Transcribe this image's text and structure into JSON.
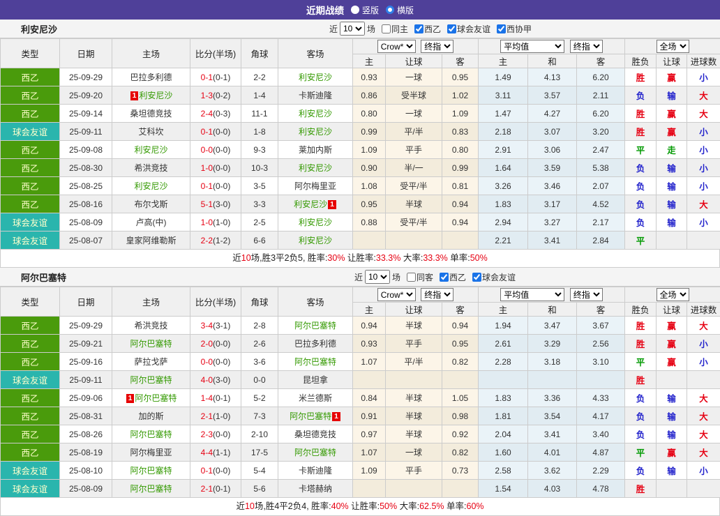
{
  "topbar": {
    "title": "近期战绩",
    "radios": [
      {
        "label": "竖版",
        "checked": false
      },
      {
        "label": "横版",
        "checked": true
      }
    ]
  },
  "table_header": {
    "cols": [
      "类型",
      "日期",
      "主场",
      "比分(半场)",
      "角球",
      "客场"
    ],
    "sub": [
      "主",
      "让球",
      "客",
      "主",
      "和",
      "客",
      "胜负",
      "让球",
      "进球数"
    ],
    "selects": [
      "Crow*",
      "终指",
      "平均值",
      "终指",
      "全场"
    ]
  },
  "labels": {
    "card_badge": "1"
  },
  "result_colors": {
    "胜": "red",
    "平": "green",
    "负": "blue",
    "赢": "red",
    "走": "green",
    "输": "blue",
    "大": "red",
    "小": "blue"
  },
  "colors": {
    "purple": "#4f4099",
    "league_green": "#4a9b0c",
    "friendly_teal": "#2ab5ad",
    "red": "#e60012",
    "blue": "#2323cc",
    "result_green": "#009900",
    "focus_team": "#339900",
    "odds_bg": "#fcf5e8",
    "avg_bg": "#eaf3f8",
    "header_bg": "#f0f0f0",
    "row_alt": "#efefef",
    "border": "#cccccc"
  },
  "sections": [
    {
      "team": "利安尼沙",
      "filters": {
        "recent": "近",
        "count": "10",
        "unit": "场",
        "checkboxes": [
          {
            "label": "同主",
            "checked": false
          },
          {
            "label": "西乙",
            "checked": true
          },
          {
            "label": "球会友谊",
            "checked": true
          },
          {
            "label": "西协甲",
            "checked": true
          }
        ]
      },
      "rows": [
        {
          "lg": "西乙",
          "lc": "g",
          "d": "25-09-29",
          "h": "巴拉多利德",
          "hf": false,
          "hb": "",
          "s": "0-1",
          "sh": "(0-1)",
          "c": "2-2",
          "a": "利安尼沙",
          "af": true,
          "ab": "",
          "o": [
            "0.93",
            "一球",
            "0.95"
          ],
          "v": [
            "1.49",
            "4.13",
            "6.20"
          ],
          "r": [
            "胜",
            "赢",
            "小"
          ]
        },
        {
          "lg": "西乙",
          "lc": "g",
          "d": "25-09-20",
          "h": "利安尼沙",
          "hf": true,
          "hb": "before",
          "s": "1-3",
          "sh": "(0-2)",
          "c": "1-4",
          "a": "卡斯迪隆",
          "af": false,
          "ab": "",
          "o": [
            "0.86",
            "受半球",
            "1.02"
          ],
          "v": [
            "3.11",
            "3.57",
            "2.11"
          ],
          "r": [
            "负",
            "输",
            "大"
          ]
        },
        {
          "lg": "西乙",
          "lc": "g",
          "d": "25-09-14",
          "h": "桑坦德竞技",
          "hf": false,
          "hb": "",
          "s": "2-4",
          "sh": "(0-3)",
          "c": "11-1",
          "a": "利安尼沙",
          "af": true,
          "ab": "",
          "o": [
            "0.80",
            "一球",
            "1.09"
          ],
          "v": [
            "1.47",
            "4.27",
            "6.20"
          ],
          "r": [
            "胜",
            "赢",
            "大"
          ]
        },
        {
          "lg": "球会友谊",
          "lc": "t",
          "d": "25-09-11",
          "h": "艾科坎",
          "hf": false,
          "hb": "",
          "s": "0-1",
          "sh": "(0-0)",
          "c": "1-8",
          "a": "利安尼沙",
          "af": true,
          "ab": "",
          "o": [
            "0.99",
            "平/半",
            "0.83"
          ],
          "v": [
            "2.18",
            "3.07",
            "3.20"
          ],
          "r": [
            "胜",
            "赢",
            "小"
          ]
        },
        {
          "lg": "西乙",
          "lc": "g",
          "d": "25-09-08",
          "h": "利安尼沙",
          "hf": true,
          "hb": "",
          "s": "0-0",
          "sh": "(0-0)",
          "c": "9-3",
          "a": "莱加内斯",
          "af": false,
          "ab": "",
          "o": [
            "1.09",
            "平手",
            "0.80"
          ],
          "v": [
            "2.91",
            "3.06",
            "2.47"
          ],
          "r": [
            "平",
            "走",
            "小"
          ]
        },
        {
          "lg": "西乙",
          "lc": "g",
          "d": "25-08-30",
          "h": "希洪竞技",
          "hf": false,
          "hb": "",
          "s": "1-0",
          "sh": "(0-0)",
          "c": "10-3",
          "a": "利安尼沙",
          "af": true,
          "ab": "",
          "o": [
            "0.90",
            "半/一",
            "0.99"
          ],
          "v": [
            "1.64",
            "3.59",
            "5.38"
          ],
          "r": [
            "负",
            "输",
            "小"
          ]
        },
        {
          "lg": "西乙",
          "lc": "g",
          "d": "25-08-25",
          "h": "利安尼沙",
          "hf": true,
          "hb": "",
          "s": "0-1",
          "sh": "(0-0)",
          "c": "3-5",
          "a": "阿尔梅里亚",
          "af": false,
          "ab": "",
          "o": [
            "1.08",
            "受平/半",
            "0.81"
          ],
          "v": [
            "3.26",
            "3.46",
            "2.07"
          ],
          "r": [
            "负",
            "输",
            "小"
          ]
        },
        {
          "lg": "西乙",
          "lc": "g",
          "d": "25-08-16",
          "h": "布尔戈斯",
          "hf": false,
          "hb": "",
          "s": "5-1",
          "sh": "(3-0)",
          "c": "3-3",
          "a": "利安尼沙",
          "af": true,
          "ab": "after",
          "o": [
            "0.95",
            "半球",
            "0.94"
          ],
          "v": [
            "1.83",
            "3.17",
            "4.52"
          ],
          "r": [
            "负",
            "输",
            "大"
          ]
        },
        {
          "lg": "球会友谊",
          "lc": "t",
          "d": "25-08-09",
          "h": "卢高(中)",
          "hf": false,
          "hb": "",
          "s": "1-0",
          "sh": "(1-0)",
          "c": "2-5",
          "a": "利安尼沙",
          "af": true,
          "ab": "",
          "o": [
            "0.88",
            "受平/半",
            "0.94"
          ],
          "v": [
            "2.94",
            "3.27",
            "2.17"
          ],
          "r": [
            "负",
            "输",
            "小"
          ]
        },
        {
          "lg": "球会友谊",
          "lc": "t",
          "d": "25-08-07",
          "h": "皇家阿维勒斯",
          "hf": false,
          "hb": "",
          "s": "2-2",
          "sh": "(1-2)",
          "c": "6-6",
          "a": "利安尼沙",
          "af": true,
          "ab": "",
          "o": [
            "",
            "",
            ""
          ],
          "v": [
            "2.21",
            "3.41",
            "2.84"
          ],
          "r": [
            "平",
            "",
            ""
          ]
        }
      ],
      "summary": [
        {
          "t": "近"
        },
        {
          "t": "10",
          "r": true
        },
        {
          "t": "场,胜3平2负5, 胜率:"
        },
        {
          "t": "30%",
          "r": true
        },
        {
          "t": " 让胜率:"
        },
        {
          "t": "33.3%",
          "r": true
        },
        {
          "t": " 大率:"
        },
        {
          "t": "33.3%",
          "r": true
        },
        {
          "t": " 单率:"
        },
        {
          "t": "50%",
          "r": true
        }
      ]
    },
    {
      "team": "阿尔巴塞特",
      "filters": {
        "recent": "近",
        "count": "10",
        "unit": "场",
        "checkboxes": [
          {
            "label": "同客",
            "checked": false
          },
          {
            "label": "西乙",
            "checked": true
          },
          {
            "label": "球会友谊",
            "checked": true
          }
        ]
      },
      "rows": [
        {
          "lg": "西乙",
          "lc": "g",
          "d": "25-09-29",
          "h": "希洪竞技",
          "hf": false,
          "hb": "",
          "s": "3-4",
          "sh": "(3-1)",
          "c": "2-8",
          "a": "阿尔巴塞特",
          "af": true,
          "ab": "",
          "o": [
            "0.94",
            "半球",
            "0.94"
          ],
          "v": [
            "1.94",
            "3.47",
            "3.67"
          ],
          "r": [
            "胜",
            "赢",
            "大"
          ]
        },
        {
          "lg": "西乙",
          "lc": "g",
          "d": "25-09-21",
          "h": "阿尔巴塞特",
          "hf": true,
          "hb": "",
          "s": "2-0",
          "sh": "(0-0)",
          "c": "2-6",
          "a": "巴拉多利德",
          "af": false,
          "ab": "",
          "o": [
            "0.93",
            "平手",
            "0.95"
          ],
          "v": [
            "2.61",
            "3.29",
            "2.56"
          ],
          "r": [
            "胜",
            "赢",
            "小"
          ]
        },
        {
          "lg": "西乙",
          "lc": "g",
          "d": "25-09-16",
          "h": "萨拉戈萨",
          "hf": false,
          "hb": "",
          "s": "0-0",
          "sh": "(0-0)",
          "c": "3-6",
          "a": "阿尔巴塞特",
          "af": true,
          "ab": "",
          "o": [
            "1.07",
            "平/半",
            "0.82"
          ],
          "v": [
            "2.28",
            "3.18",
            "3.10"
          ],
          "r": [
            "平",
            "赢",
            "小"
          ]
        },
        {
          "lg": "球会友谊",
          "lc": "t",
          "d": "25-09-11",
          "h": "阿尔巴塞特",
          "hf": true,
          "hb": "",
          "s": "4-0",
          "sh": "(3-0)",
          "c": "0-0",
          "a": "昆坦拿",
          "af": false,
          "ab": "",
          "o": [
            "",
            "",
            ""
          ],
          "v": [
            "",
            "",
            ""
          ],
          "r": [
            "胜",
            "",
            ""
          ]
        },
        {
          "lg": "西乙",
          "lc": "g",
          "d": "25-09-06",
          "h": "阿尔巴塞特",
          "hf": true,
          "hb": "before",
          "s": "1-4",
          "sh": "(0-1)",
          "c": "5-2",
          "a": "米兰德斯",
          "af": false,
          "ab": "",
          "o": [
            "0.84",
            "半球",
            "1.05"
          ],
          "v": [
            "1.83",
            "3.36",
            "4.33"
          ],
          "r": [
            "负",
            "输",
            "大"
          ]
        },
        {
          "lg": "西乙",
          "lc": "g",
          "d": "25-08-31",
          "h": "加的斯",
          "hf": false,
          "hb": "",
          "s": "2-1",
          "sh": "(1-0)",
          "c": "7-3",
          "a": "阿尔巴塞特",
          "af": true,
          "ab": "after",
          "o": [
            "0.91",
            "半球",
            "0.98"
          ],
          "v": [
            "1.81",
            "3.54",
            "4.17"
          ],
          "r": [
            "负",
            "输",
            "大"
          ]
        },
        {
          "lg": "西乙",
          "lc": "g",
          "d": "25-08-26",
          "h": "阿尔巴塞特",
          "hf": true,
          "hb": "",
          "s": "2-3",
          "sh": "(0-0)",
          "c": "2-10",
          "a": "桑坦德竞技",
          "af": false,
          "ab": "",
          "o": [
            "0.97",
            "半球",
            "0.92"
          ],
          "v": [
            "2.04",
            "3.41",
            "3.40"
          ],
          "r": [
            "负",
            "输",
            "大"
          ]
        },
        {
          "lg": "西乙",
          "lc": "g",
          "d": "25-08-19",
          "h": "阿尔梅里亚",
          "hf": false,
          "hb": "",
          "s": "4-4",
          "sh": "(1-1)",
          "c": "17-5",
          "a": "阿尔巴塞特",
          "af": true,
          "ab": "",
          "o": [
            "1.07",
            "一球",
            "0.82"
          ],
          "v": [
            "1.60",
            "4.01",
            "4.87"
          ],
          "r": [
            "平",
            "赢",
            "大"
          ]
        },
        {
          "lg": "球会友谊",
          "lc": "t",
          "d": "25-08-10",
          "h": "阿尔巴塞特",
          "hf": true,
          "hb": "",
          "s": "0-1",
          "sh": "(0-0)",
          "c": "5-4",
          "a": "卡斯迪隆",
          "af": false,
          "ab": "",
          "o": [
            "1.09",
            "平手",
            "0.73"
          ],
          "v": [
            "2.58",
            "3.62",
            "2.29"
          ],
          "r": [
            "负",
            "输",
            "小"
          ]
        },
        {
          "lg": "球会友谊",
          "lc": "t",
          "d": "25-08-09",
          "h": "阿尔巴塞特",
          "hf": true,
          "hb": "",
          "s": "2-1",
          "sh": "(0-1)",
          "c": "5-6",
          "a": "卡塔赫纳",
          "af": false,
          "ab": "",
          "o": [
            "",
            "",
            ""
          ],
          "v": [
            "1.54",
            "4.03",
            "4.78"
          ],
          "r": [
            "胜",
            "",
            ""
          ]
        }
      ],
      "summary": [
        {
          "t": "近"
        },
        {
          "t": "10",
          "r": true
        },
        {
          "t": "场,胜4平2负4, 胜率:"
        },
        {
          "t": "40%",
          "r": true
        },
        {
          "t": " 让胜率:"
        },
        {
          "t": "50%",
          "r": true
        },
        {
          "t": " 大率:"
        },
        {
          "t": "62.5%",
          "r": true
        },
        {
          "t": " 单率:"
        },
        {
          "t": "60%",
          "r": true
        }
      ]
    }
  ]
}
